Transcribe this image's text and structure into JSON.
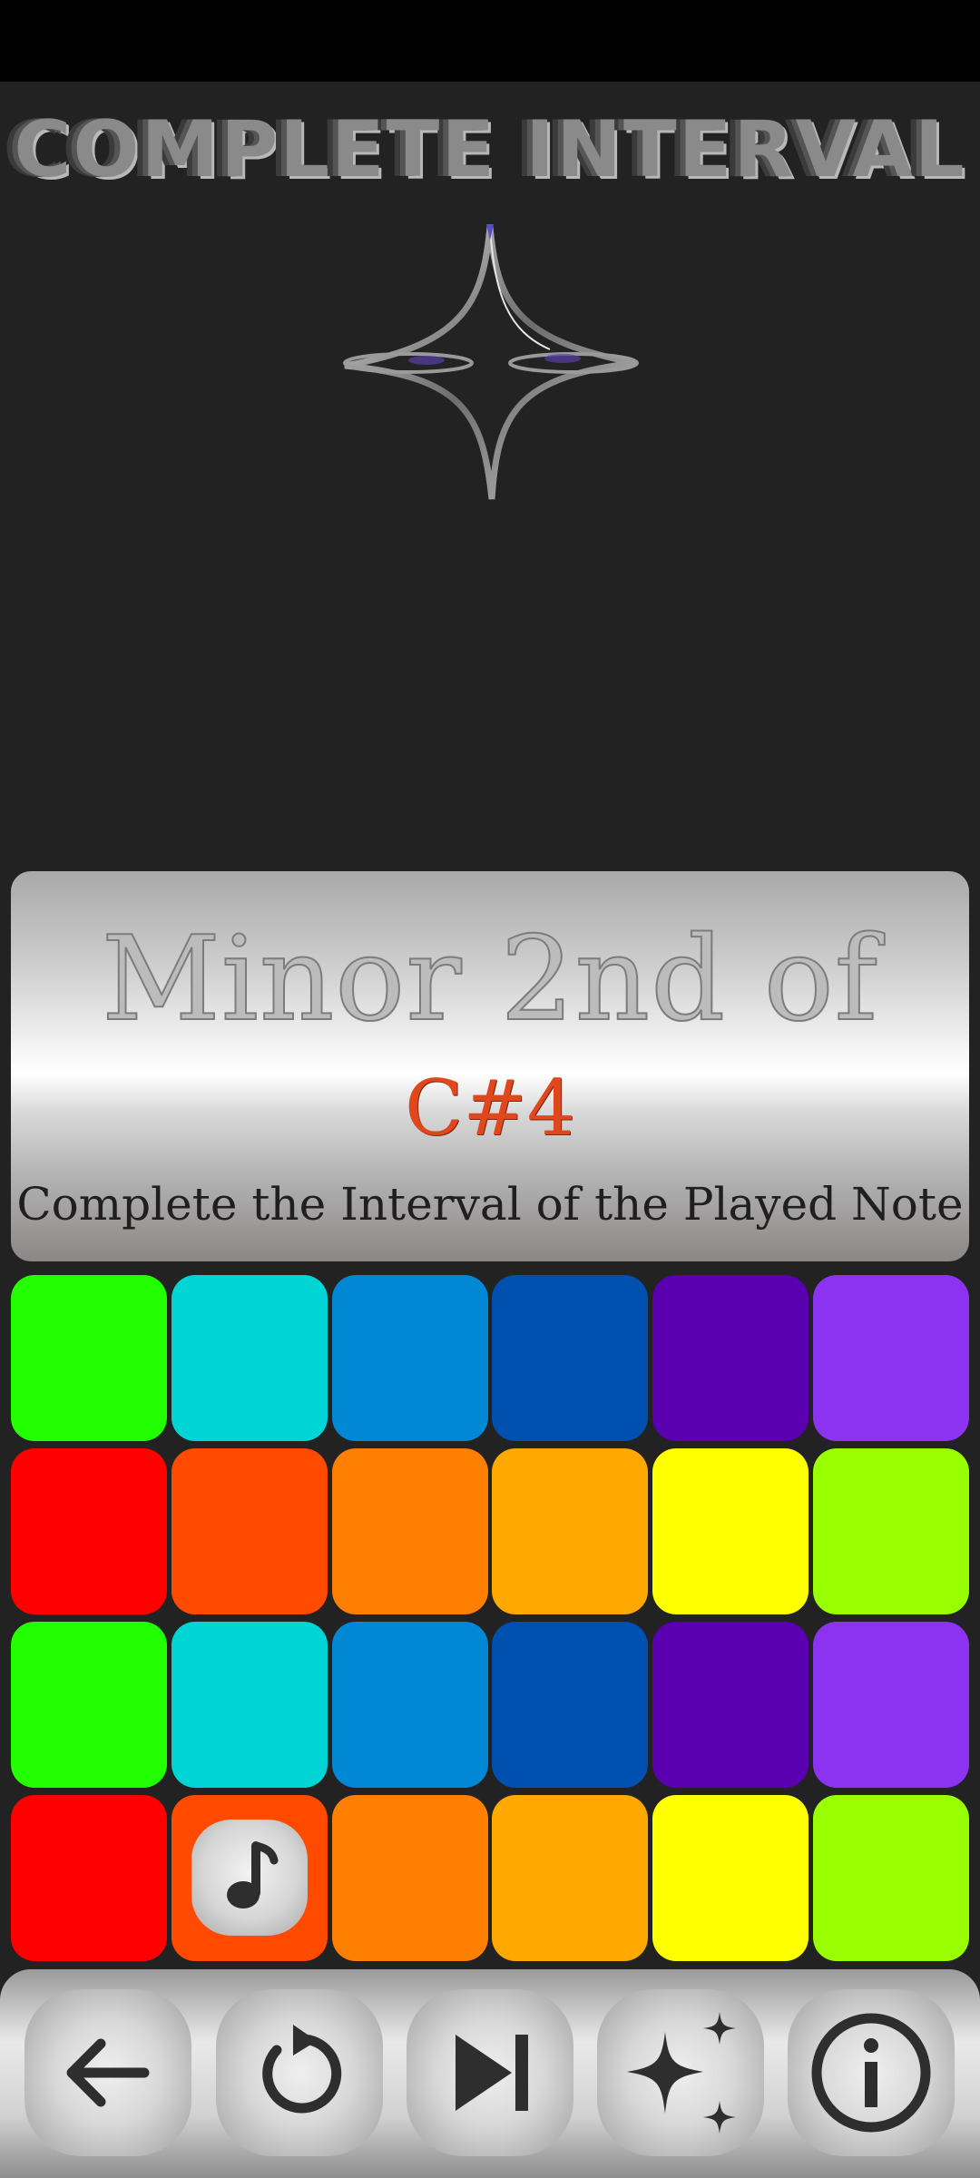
{
  "app": {
    "title": "COMPLETE INTERVAL"
  },
  "prompt": {
    "interval": "Minor 2nd of",
    "base_note": "C#4",
    "instruction": "Complete the Interval of the Played Note"
  },
  "pad_grid": {
    "rows": [
      [
        "#22ff00",
        "#00d4d4",
        "#0088d4",
        "#0050b0",
        "#5a00b0",
        "#8b33f0"
      ],
      [
        "#ff0000",
        "#ff4a00",
        "#ff8000",
        "#ffa800",
        "#ffff00",
        "#99ff00"
      ],
      [
        "#22ff00",
        "#00d4d4",
        "#0088d4",
        "#0050b0",
        "#5a00b0",
        "#8b33f0"
      ],
      [
        "#ff0000",
        "#ff4a00",
        "#ff8000",
        "#ffa800",
        "#ffff00",
        "#99ff00"
      ]
    ],
    "marked_pad": {
      "row": 3,
      "col": 1,
      "icon": "music-note-icon"
    }
  },
  "toolbar": {
    "buttons": [
      {
        "name": "back-button",
        "icon": "arrow-left-icon"
      },
      {
        "name": "replay-button",
        "icon": "replay-icon"
      },
      {
        "name": "skip-button",
        "icon": "skip-next-icon"
      },
      {
        "name": "hint-button",
        "icon": "sparkles-icon"
      },
      {
        "name": "info-button",
        "icon": "info-icon"
      }
    ]
  },
  "colors": {
    "background": "#222222",
    "accent": "#e0471c",
    "icon": "#2e2e2e"
  }
}
